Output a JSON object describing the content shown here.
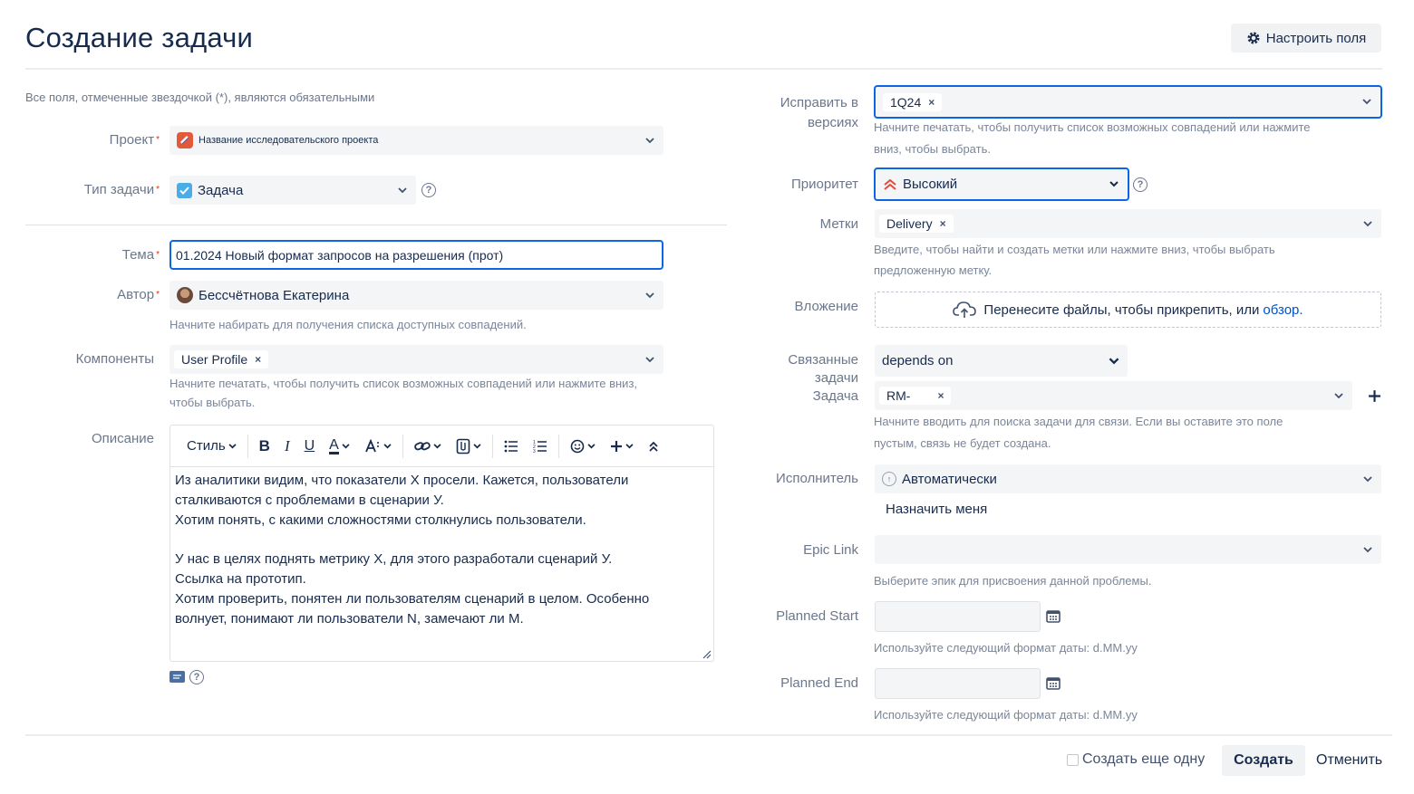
{
  "header": {
    "title": "Создание задачи",
    "configure_fields_label": "Настроить поля"
  },
  "required_note": "Все поля, отмеченные звездочкой (*), являются обязательными",
  "required_marker": "*",
  "left": {
    "project": {
      "label": "Проект",
      "value": "Название исследовательского проекта"
    },
    "issue_type": {
      "label": "Тип задачи",
      "value": "Задача"
    },
    "summary": {
      "label": "Тема",
      "value": "01.2024 Новый формат запросов на разрешения (прот)"
    },
    "reporter": {
      "label": "Автор",
      "value": "Бессчётнова Екатерина",
      "hint": "Начните набирать для получения списка доступных совпадений."
    },
    "components": {
      "label": "Компоненты",
      "tags": [
        "User Profile"
      ],
      "hint_line1": "Начните печатать, чтобы получить список возможных совпадений или нажмите вниз,",
      "hint_line2": "чтобы выбрать."
    },
    "description": {
      "label": "Описание",
      "toolbar": {
        "style_label": "Стиль"
      },
      "lines": [
        "Из аналитики видим, что показатели Х просели. Кажется, пользователи",
        "сталкиваются с проблемами в сценарии У.",
        "Хотим понять, с какими сложностями столкнулись пользователи.",
        "",
        "У нас в целях поднять метрику Х, для этого разработали сценарий У.",
        "Ссылка на прототип.",
        "Хотим проверить, понятен ли пользователям сценарий в целом. Особенно",
        "волнует, понимают ли пользователи N, замечают ли M."
      ]
    }
  },
  "right": {
    "fix_versions": {
      "label_line1": "Исправить в",
      "label_line2": "версиях",
      "tags": [
        "1Q24"
      ],
      "hint_line1": "Начните печатать, чтобы получить список возможных совпадений или нажмите",
      "hint_line2": "вниз, чтобы выбрать."
    },
    "priority": {
      "label": "Приоритет",
      "value": "Высокий"
    },
    "labels": {
      "label": "Метки",
      "tags": [
        "Delivery"
      ],
      "hint_line1": "Введите, чтобы найти и создать метки или нажмите вниз, чтобы выбрать",
      "hint_line2": "предложенную метку."
    },
    "attachment": {
      "label": "Вложение",
      "drop_text": "Перенесите файлы, чтобы прикрепить, или",
      "browse_link": "обзор."
    },
    "linked_issues": {
      "label_line1": "Связанные",
      "label_line2": "задачи",
      "label_line3": "Задача",
      "relation": "depends on",
      "tags": [
        "RM-"
      ],
      "hint_line1": "Начните вводить для поиска задачи для связи. Если вы оставите это поле",
      "hint_line2": "пустым, связь не будет создана."
    },
    "assignee": {
      "label": "Исполнитель",
      "value": "Автоматически",
      "assign_me": "Назначить меня"
    },
    "epic_link": {
      "label": "Epic Link",
      "value": "",
      "hint": "Выберите эпик для присвоения данной проблемы."
    },
    "planned_start": {
      "label": "Planned Start",
      "value": "",
      "hint": "Используйте следующий формат даты: d.MM.yy"
    },
    "planned_end": {
      "label": "Planned End",
      "value": "",
      "hint": "Используйте следующий формат даты: d.MM.yy"
    }
  },
  "footer": {
    "create_another_label": "Создать еще одну",
    "create_button": "Создать",
    "cancel_link": "Отменить"
  },
  "colors": {
    "focus_border": "#0c66e4",
    "priority_high": "#e5493a",
    "link": "#0052cc"
  }
}
